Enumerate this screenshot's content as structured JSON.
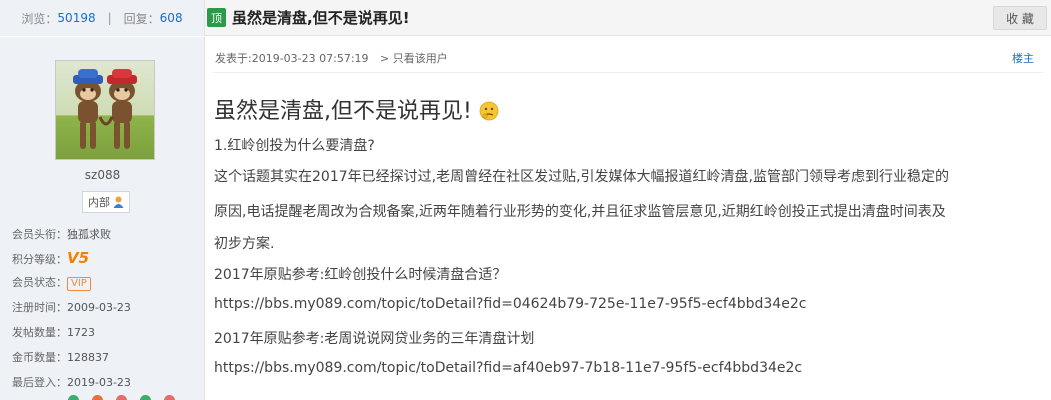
{
  "topbar": {
    "views_label": "浏览：",
    "views_count": "50198",
    "separator": "|",
    "replies_label": "回复：",
    "replies_count": "608",
    "top_badge": "顶",
    "thread_title": "虽然是清盘,但不是说再见!",
    "favorite_label": "收 藏"
  },
  "author": {
    "username": "sz088",
    "department": "内部",
    "titles": [
      {
        "label": "会员头衔：",
        "value": "独孤求败"
      },
      {
        "label": "积分等级：",
        "value": "V5"
      },
      {
        "label": "会员状态：",
        "value": "VIP"
      },
      {
        "label": "注册时间：",
        "value": "2009-03-23"
      },
      {
        "label": "发帖数量：",
        "value": "1723"
      },
      {
        "label": "金币数量：",
        "value": "128837"
      },
      {
        "label": "最后登入：",
        "value": "2019-03-23"
      }
    ]
  },
  "post": {
    "posted_label": "发表于:",
    "posted_time": "2019-03-23 07:57:19",
    "only_author": "> 只看该用户",
    "floor_label": "楼主",
    "title": "虽然是清盘,但不是说再见!",
    "body": [
      "1.红岭创投为什么要清盘?",
      "这个话题其实在2017年已经探讨过,老周曾经在社区发过贴,引发媒体大幅报道红岭清盘,监管部门领导考虑到行业稳定的",
      "原因,电话提醒老周改为合规备案,近两年随着行业形势的变化,并且征求监管层意见,近期红岭创投正式提出清盘时间表及",
      "初步方案.",
      "2017年原贴参考:红岭创投什么时候清盘合适？"
    ],
    "link1": "https://bbs.my089.com/topic/toDetail?fid=04624b79-725e-11e7-95f5-ecf4bbd34e2c",
    "ref2": "2017年原贴参考:老周说说网贷业务的三年清盘计划",
    "link2": "https://bbs.my089.com/topic/toDetail?fid=af40eb97-7b18-11e7-95f5-ecf4bbd34e2c"
  },
  "colors": {
    "accent_blue": "#1e6cc5",
    "sidebar_bg": "#eef2f6",
    "top_badge_green": "#2e9a48",
    "vip_orange": "#f08a3c"
  }
}
